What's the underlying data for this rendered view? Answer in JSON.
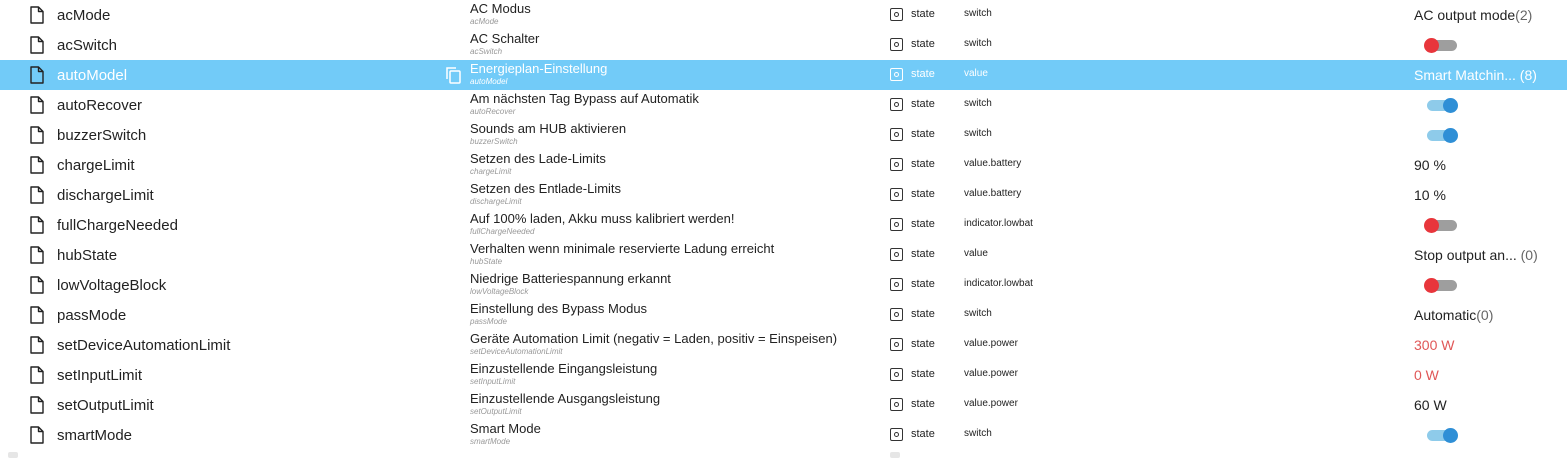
{
  "type_label": "state",
  "rows": [
    {
      "id": "acMode",
      "name": "AC Modus",
      "sub": "acMode",
      "role": "switch",
      "value": "AC output mode",
      "count": "(2)"
    },
    {
      "id": "acSwitch",
      "name": "AC Schalter",
      "sub": "acSwitch",
      "role": "switch",
      "toggle": "off"
    },
    {
      "id": "autoModel",
      "name": "Energieplan-Einstellung",
      "sub": "autoModel",
      "role": "value",
      "value": "Smart Matchin...",
      "count": " (8)",
      "selected": true
    },
    {
      "id": "autoRecover",
      "name": "Am nächsten Tag Bypass auf Automatik",
      "sub": "autoRecover",
      "role": "switch",
      "toggle": "on"
    },
    {
      "id": "buzzerSwitch",
      "name": "Sounds am HUB aktivieren",
      "sub": "buzzerSwitch",
      "role": "switch",
      "toggle": "on"
    },
    {
      "id": "chargeLimit",
      "name": "Setzen des Lade-Limits",
      "sub": "chargeLimit",
      "role": "value.battery",
      "value": "90 %"
    },
    {
      "id": "dischargeLimit",
      "name": "Setzen des Entlade-Limits",
      "sub": "dischargeLimit",
      "role": "value.battery",
      "value": "10 %"
    },
    {
      "id": "fullChargeNeeded",
      "name": "Auf 100% laden, Akku muss kalibriert werden!",
      "sub": "fullChargeNeeded",
      "role": "indicator.lowbat",
      "toggle": "off"
    },
    {
      "id": "hubState",
      "name": "Verhalten wenn minimale reservierte Ladung erreicht",
      "sub": "hubState",
      "role": "value",
      "value": "Stop output an...",
      "count": " (0)"
    },
    {
      "id": "lowVoltageBlock",
      "name": "Niedrige Batteriespannung erkannt",
      "sub": "lowVoltageBlock",
      "role": "indicator.lowbat",
      "toggle": "off"
    },
    {
      "id": "passMode",
      "name": "Einstellung des Bypass Modus",
      "sub": "passMode",
      "role": "switch",
      "value": "Automatic",
      "count": "(0)"
    },
    {
      "id": "setDeviceAutomationLimit",
      "name": "Geräte Automation Limit (negativ = Laden, positiv = Einspeisen)",
      "sub": "setDeviceAutomationLimit",
      "role": "value.power",
      "value": "300 W",
      "value_color": "red"
    },
    {
      "id": "setInputLimit",
      "name": "Einzustellende Eingangsleistung",
      "sub": "setInputLimit",
      "role": "value.power",
      "value": "0 W",
      "value_color": "red"
    },
    {
      "id": "setOutputLimit",
      "name": "Einzustellende Ausgangsleistung",
      "sub": "setOutputLimit",
      "role": "value.power",
      "value": "60 W"
    },
    {
      "id": "smartMode",
      "name": "Smart Mode",
      "sub": "smartMode",
      "role": "switch",
      "toggle": "on"
    }
  ]
}
